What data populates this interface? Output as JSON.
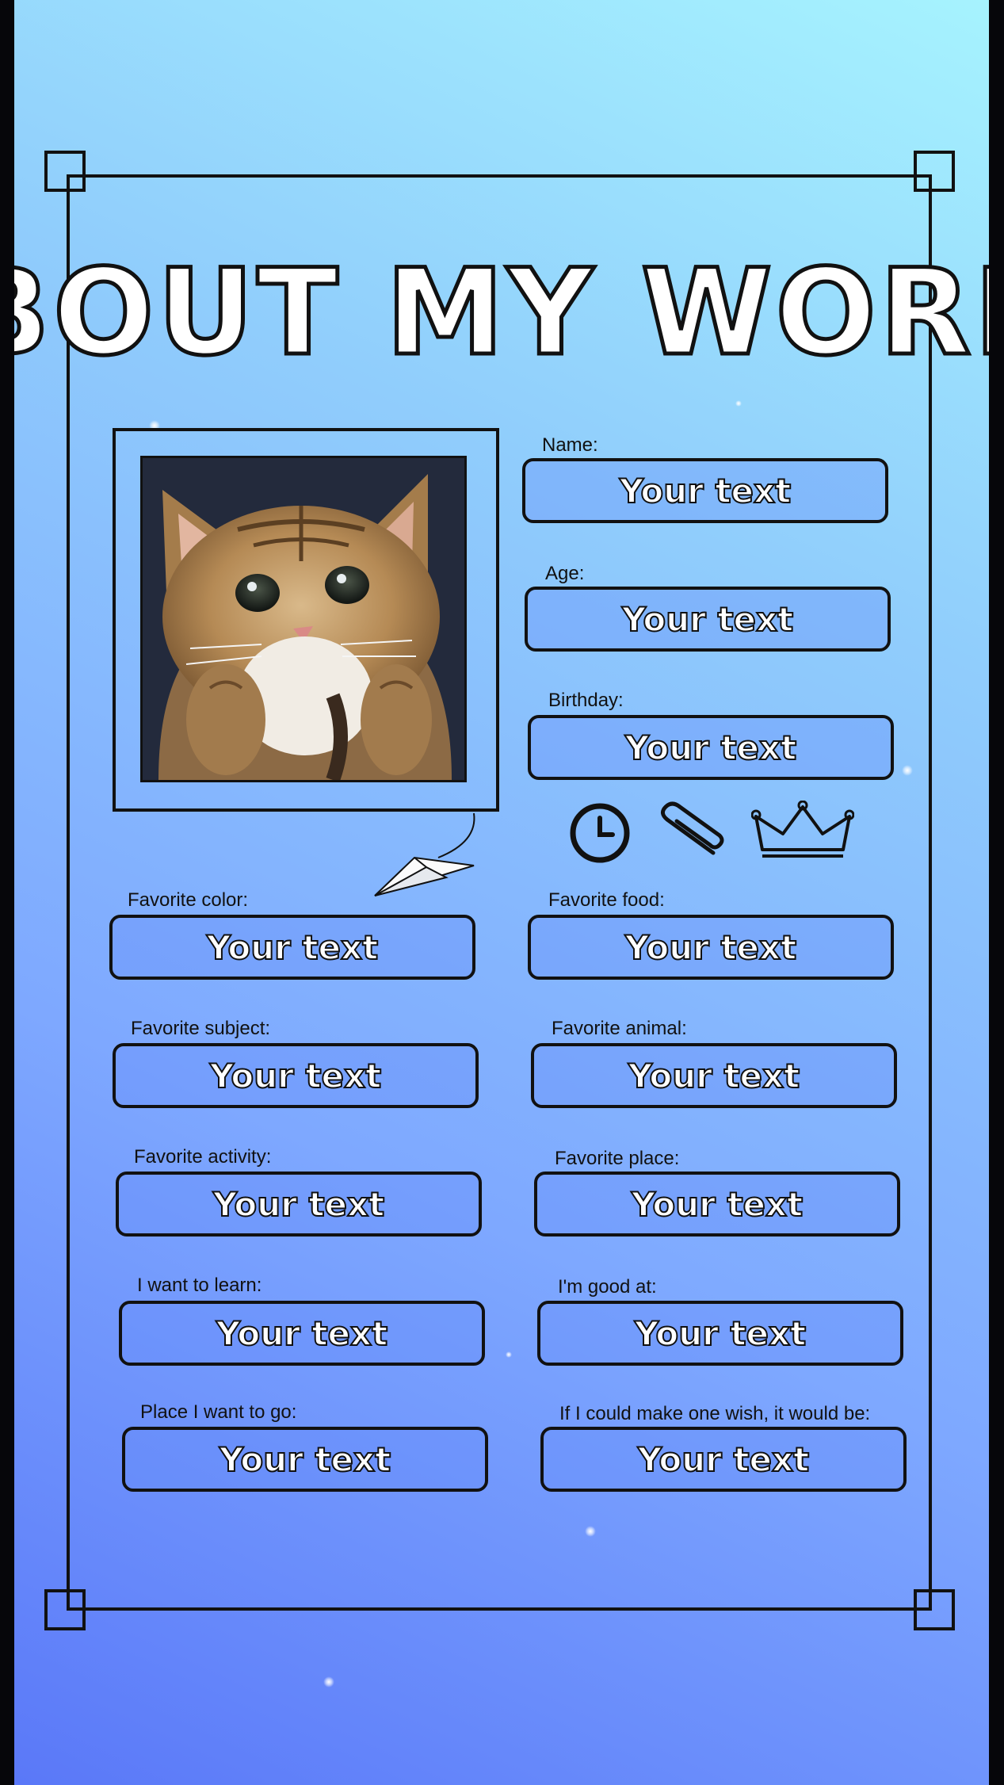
{
  "title": "ABOUT MY WORLD",
  "fields": [
    {
      "label": "Name:",
      "value": "Your text"
    },
    {
      "label": "Age:",
      "value": "Your text"
    },
    {
      "label": "Birthday:",
      "value": "Your text"
    },
    {
      "label": "Favorite color:",
      "value": "Your text"
    },
    {
      "label": "Favorite food:",
      "value": "Your text"
    },
    {
      "label": "Favorite subject:",
      "value": "Your text"
    },
    {
      "label": "Favorite animal:",
      "value": "Your text"
    },
    {
      "label": "Favorite activity:",
      "value": "Your text"
    },
    {
      "label": "Favorite place:",
      "value": "Your text"
    },
    {
      "label": "I want to learn:",
      "value": "Your text"
    },
    {
      "label": "I'm good at:",
      "value": "Your text"
    },
    {
      "label": "Place I want to go:",
      "value": "Your text"
    },
    {
      "label": "If I could make one wish, it would be:",
      "value": "Your text"
    }
  ],
  "icons": [
    "clock-icon",
    "paperclip-icon",
    "crown-icon",
    "paper-plane-icon"
  ],
  "colors": {
    "background_top": "#a6f3fe",
    "background_bottom": "#5a78f8",
    "outline": "#111111",
    "text_fill": "#ffffff"
  }
}
